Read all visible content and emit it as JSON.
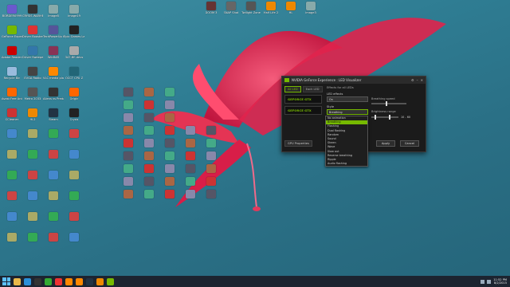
{
  "desktop_icons": [
    {
      "label": "BORDER0999",
      "color": "#6a5acd"
    },
    {
      "label": "CRYSIS WARHEAD",
      "color": "#333"
    },
    {
      "label": "image8",
      "color": "#8aa"
    },
    {
      "label": "image19",
      "color": "#8aa"
    },
    {
      "label": "GeForce Experience",
      "color": "#76b900"
    },
    {
      "label": "Driver Booster 2",
      "color": "#d33"
    },
    {
      "label": "TechPowerUp GPU-Z",
      "color": "#559"
    },
    {
      "label": "Epic Games Launcher",
      "color": "#222"
    },
    {
      "label": "Adobe Reader XI",
      "color": "#c00"
    },
    {
      "label": "Driver Sweeper",
      "color": "#37a"
    },
    {
      "label": "WinRAR",
      "color": "#835"
    },
    {
      "label": "347-BE-devs",
      "color": "#aaa"
    },
    {
      "label": "Recycle Bin",
      "color": "#9bd"
    },
    {
      "label": "EVGA Radio",
      "color": "#444"
    },
    {
      "label": "VLC media player",
      "color": "#f80"
    },
    {
      "label": "OCCT CPU Z",
      "color": "#267"
    },
    {
      "label": "Avast Free Antivirus",
      "color": "#f60"
    },
    {
      "label": "Metro 2033",
      "color": "#555"
    },
    {
      "label": "Aliens vs Predator",
      "color": "#333"
    },
    {
      "label": "Origin",
      "color": "#f60"
    },
    {
      "label": "CCleaner",
      "color": "#c33"
    },
    {
      "label": "HL2",
      "color": "#e80"
    },
    {
      "label": "Steam",
      "color": "#234"
    },
    {
      "label": "Crysis",
      "color": "#222"
    }
  ],
  "top_icons": [
    {
      "label": "DOOM 3",
      "color": "#633"
    },
    {
      "label": "SNAP Shot",
      "color": "#666"
    },
    {
      "label": "Twilight Zone",
      "color": "#555"
    },
    {
      "label": "Half Life 2",
      "color": "#e80"
    },
    {
      "label": "HL",
      "color": "#e80"
    },
    {
      "label": "image3",
      "color": "#8aa"
    }
  ],
  "window": {
    "title": "NVIDIA GeForce Experience : LED Visualizer",
    "tabs": [
      "All LED",
      "Each LED"
    ],
    "gpus": [
      "GEFORCE GTX",
      "GEFORCE GTX"
    ],
    "gpu_properties": "GPU Properties",
    "effects_title": "Effects for all LEDs",
    "led_effects_label": "LED effects",
    "led_effects_value": "On",
    "style_label": "Style",
    "style_value": "Breathing",
    "style_options": [
      "No animation",
      "Breathing",
      "Flashing",
      "Dual flashing",
      "Random",
      "Sound",
      "Sheen",
      "Wave",
      "Slow out",
      "Reverse breathing",
      "Ripple",
      "Audio flashing"
    ],
    "selected_option_index": 1,
    "breathing_speed_label": "Breathing speed",
    "brightness_label": "Brightness range",
    "brightness_value": "10 - 60",
    "apply": "Apply",
    "cancel": "Cancel"
  },
  "taskbar": {
    "icons": [
      {
        "name": "file-explorer-icon",
        "color": "#e8b84a"
      },
      {
        "name": "ie-icon",
        "color": "#2a8fd8"
      },
      {
        "name": "store-icon",
        "color": "#333"
      },
      {
        "name": "xbox-icon",
        "color": "#3a3"
      },
      {
        "name": "chrome-icon",
        "color": "#e33"
      },
      {
        "name": "firefox-icon",
        "color": "#f80"
      },
      {
        "name": "vlc-icon",
        "color": "#f80"
      },
      {
        "name": "steam-icon",
        "color": "#234"
      },
      {
        "name": "hl-icon",
        "color": "#e80"
      },
      {
        "name": "geforce-icon",
        "color": "#76b900"
      }
    ],
    "clock_time": "11:52 PM",
    "clock_date": "8/2/2015"
  }
}
